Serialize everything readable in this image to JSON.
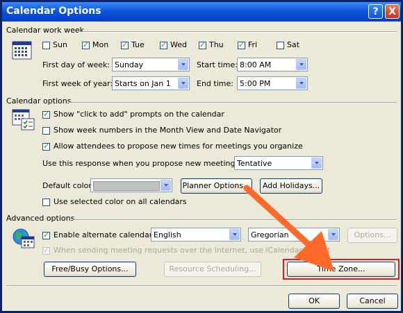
{
  "window": {
    "title": "Calendar Options",
    "help_glyph": "?",
    "close_glyph": "X"
  },
  "work_week": {
    "header": "Calendar work week",
    "days": [
      {
        "label": "Sun",
        "checked": false
      },
      {
        "label": "Mon",
        "checked": true
      },
      {
        "label": "Tue",
        "checked": true
      },
      {
        "label": "Wed",
        "checked": true
      },
      {
        "label": "Thu",
        "checked": true
      },
      {
        "label": "Fri",
        "checked": true
      },
      {
        "label": "Sat",
        "checked": false
      }
    ],
    "first_day_label": "First day of week:",
    "first_day_value": "Sunday",
    "start_time_label": "Start time:",
    "start_time_value": "8:00 AM",
    "first_week_label": "First week of year:",
    "first_week_value": "Starts on Jan 1",
    "end_time_label": "End time:",
    "end_time_value": "5:00 PM"
  },
  "calendar_options": {
    "header": "Calendar options",
    "show_click_to_add": {
      "label": "Show \"click to add\" prompts on the calendar",
      "checked": true
    },
    "show_week_numbers": {
      "label": "Show week numbers in the Month View and Date Navigator",
      "checked": false
    },
    "allow_attendees": {
      "label": "Allow attendees to propose new times for meetings you organize",
      "checked": true
    },
    "response_label": "Use this response when you propose new meeting times:",
    "response_value": "Tentative",
    "default_color_label": "Default color:",
    "planner_options": "Planner Options...",
    "add_holidays": "Add Holidays...",
    "use_selected_color": {
      "label": "Use selected color on all calendars",
      "checked": false
    }
  },
  "advanced_options": {
    "header": "Advanced options",
    "enable_alternate": {
      "label": "Enable alternate calendar:",
      "checked": true
    },
    "language_value": "English",
    "calendar_value": "Gregorian",
    "options_button": "Options...",
    "icalendar": {
      "label": "When sending meeting requests over the Internet, use iCalendar format",
      "checked": true
    },
    "free_busy": "Free/Busy Options...",
    "resource_scheduling": "Resource Scheduling...",
    "time_zone": "Time Zone..."
  },
  "footer": {
    "ok": "OK",
    "cancel": "Cancel"
  },
  "colors": {
    "highlight": "#d71f1f",
    "annotation_arrow": "#ff6a2b",
    "title_bar": "#0a53d8"
  }
}
